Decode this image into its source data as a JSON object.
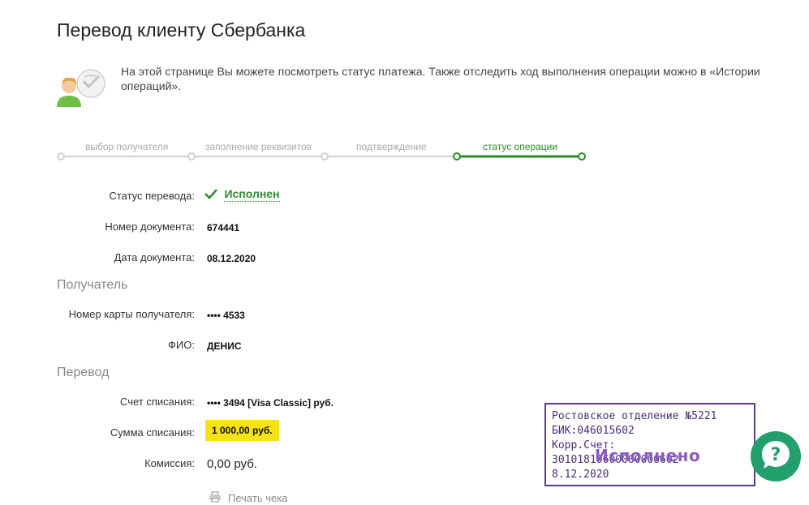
{
  "page": {
    "title": "Перевод клиенту Сбербанка",
    "intro": "На этой странице Вы можете посмотреть статус платежа. Также отследить ход выполнения операции можно в «Истории операций»."
  },
  "steps": [
    {
      "label": "выбор получателя",
      "state": "done"
    },
    {
      "label": "заполнение реквизитов",
      "state": "done"
    },
    {
      "label": "подтверждение",
      "state": "done"
    },
    {
      "label": "статус операции",
      "state": "active"
    }
  ],
  "details": {
    "status_label": "Статус перевода:",
    "status_value": "Исполнен",
    "doc_number_label": "Номер документа:",
    "doc_number_value": "674441",
    "doc_date_label": "Дата документа:",
    "doc_date_value": "08.12.2020"
  },
  "recipient": {
    "section": "Получатель",
    "card_label": "Номер карты получателя:",
    "card_value": "•••• 4533",
    "name_label": "ФИО:",
    "name_value": "ДЕНИС"
  },
  "transfer": {
    "section": "Перевод",
    "account_label": "Счет списания:",
    "account_value": "•••• 3494  [Visa Classic]  руб.",
    "amount_label": "Сумма списания:",
    "amount_value": "1 000,00  руб.",
    "commission_label": "Комиссия:",
    "commission_value": "0,00 руб."
  },
  "print_label": "Печать чека",
  "stamp": {
    "line1": "Ростовское отделение №5221",
    "line2": "БИК:046015602",
    "line3": "Корр.Счет: 30101810600000000602",
    "status": "Исполнено",
    "date": "8.12.2020"
  },
  "colors": {
    "accent_green": "#2e8b2e",
    "highlight_yellow": "#f5e217",
    "stamp_purple": "#4b2d78",
    "help_button": "#21a06d"
  }
}
